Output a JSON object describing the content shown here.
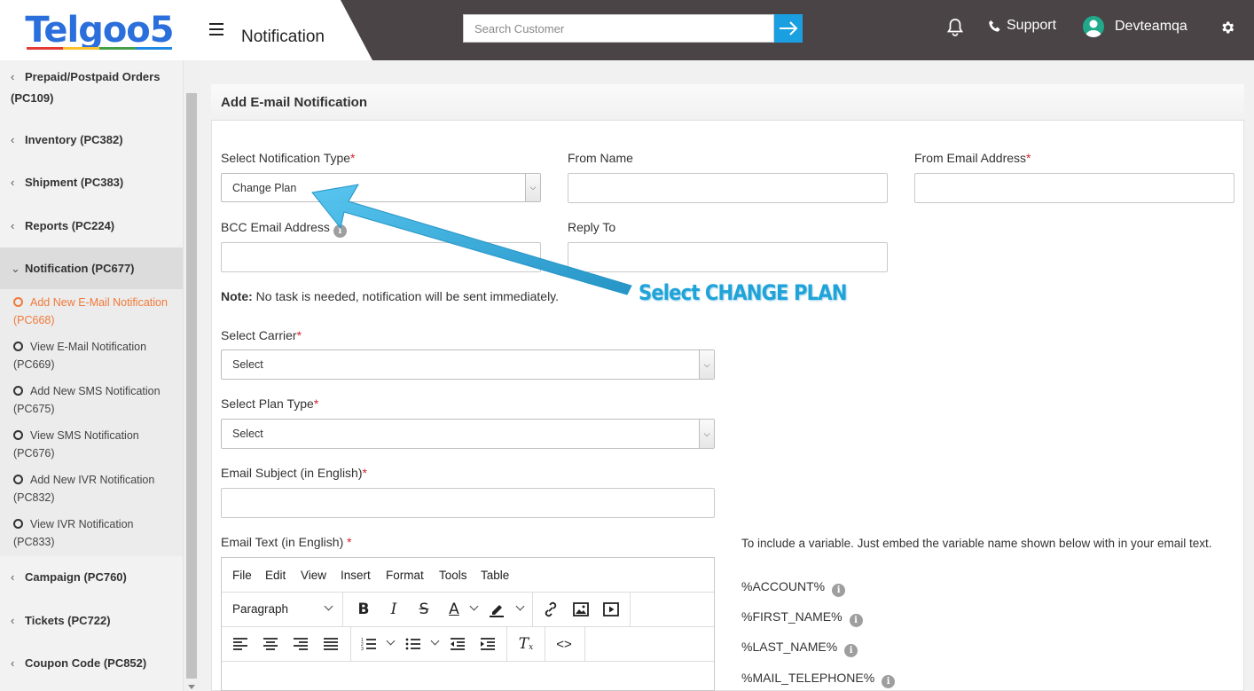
{
  "brand": {
    "logo_text": "Telgoo5"
  },
  "header": {
    "title": "Notification",
    "search_placeholder": "Search Customer",
    "support_label": "Support",
    "user_name": "Devteamqa"
  },
  "sidebar": {
    "items": [
      {
        "label": "Prepaid/Postpaid Orders (PC109)"
      },
      {
        "label": "Inventory (PC382)"
      },
      {
        "label": "Shipment (PC383)"
      },
      {
        "label": "Reports (PC224)"
      },
      {
        "label": "Notification (PC677)"
      },
      {
        "label": "Campaign (PC760)"
      },
      {
        "label": "Tickets (PC722)"
      },
      {
        "label": "Coupon Code (PC852)"
      }
    ],
    "sub_items": [
      {
        "label": "Add New E-Mail Notification (PC668)"
      },
      {
        "label": "View E-Mail Notification (PC669)"
      },
      {
        "label": "Add New SMS Notification (PC675)"
      },
      {
        "label": "View SMS Notification (PC676)"
      },
      {
        "label": "Add New IVR Notification (PC832)"
      },
      {
        "label": "View IVR Notification (PC833)"
      }
    ]
  },
  "form": {
    "title": "Add E-mail Notification",
    "notification_type": {
      "label": "Select Notification Type",
      "value": "Change Plan"
    },
    "from_name": {
      "label": "From Name",
      "value": ""
    },
    "from_email": {
      "label": "From Email Address",
      "value": ""
    },
    "bcc_email": {
      "label": "BCC Email Address",
      "value": ""
    },
    "reply_to": {
      "label": "Reply To",
      "value": ""
    },
    "note": {
      "bold": "Note:",
      "text": " No task is needed, notification will be sent immediately."
    },
    "carrier": {
      "label": "Select Carrier",
      "value": "Select"
    },
    "plan_type": {
      "label": "Select Plan Type",
      "value": "Select"
    },
    "email_subject": {
      "label": "Email Subject (in English)",
      "value": ""
    },
    "email_text": {
      "label": "Email Text (in English)"
    },
    "required_mark": "*"
  },
  "editor": {
    "menus": [
      "File",
      "Edit",
      "View",
      "Insert",
      "Format",
      "Tools",
      "Table"
    ],
    "block_format": "Paragraph"
  },
  "variables": {
    "intro": "To include a variable. Just embed the variable name shown below with in your email text.",
    "items": [
      "%ACCOUNT%",
      "%FIRST_NAME%",
      "%LAST_NAME%",
      "%MAIL_TELEPHONE%"
    ]
  },
  "annotation": {
    "text": "Select CHANGE PLAN",
    "color": "#1fa3d8"
  }
}
